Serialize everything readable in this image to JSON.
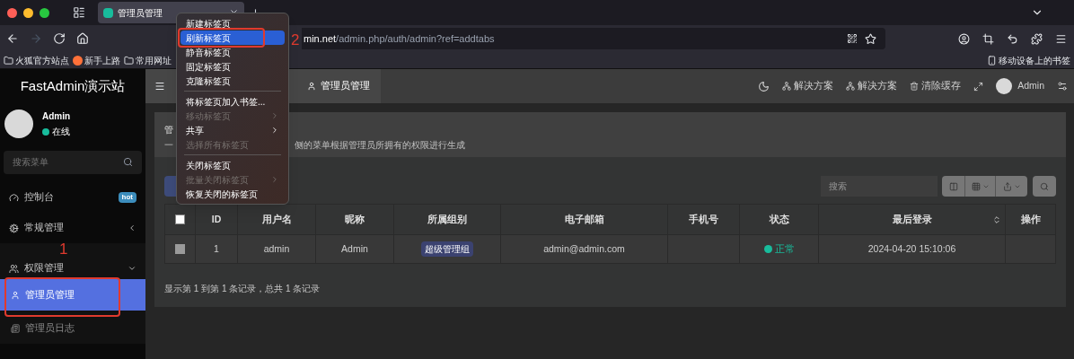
{
  "browser": {
    "tab": {
      "title": "管理员管理"
    },
    "nav_buttons": [
      {
        "kind": "back",
        "disabled": false
      },
      {
        "kind": "forward",
        "disabled": true
      },
      {
        "kind": "reload",
        "disabled": false
      },
      {
        "kind": "home",
        "disabled": false
      }
    ],
    "url": {
      "host": "min.net",
      "path": "/admin.php/auth/admin?ref=addtabs"
    },
    "bookmarks": [
      {
        "label": "火狐官方站点",
        "kind": "folder"
      },
      {
        "label": "新手上路",
        "kind": "firefox"
      },
      {
        "label": "常用网址",
        "kind": "folder"
      }
    ],
    "mobile_bookmarks": "移动设备上的书签"
  },
  "context_menu": {
    "items": [
      {
        "kind": "item",
        "label": "新建标签页",
        "selected": false,
        "disabled": false,
        "submenu": false
      },
      {
        "kind": "item",
        "label": "刷新标签页",
        "selected": true,
        "disabled": false,
        "submenu": false
      },
      {
        "kind": "item",
        "label": "静音标签页",
        "selected": false,
        "disabled": false,
        "submenu": false
      },
      {
        "kind": "item",
        "label": "固定标签页",
        "selected": false,
        "disabled": false,
        "submenu": false
      },
      {
        "kind": "item",
        "label": "克隆标签页",
        "selected": false,
        "disabled": false,
        "submenu": false
      },
      {
        "kind": "separator"
      },
      {
        "kind": "item",
        "label": "将标签页加入书签...",
        "selected": false,
        "disabled": false,
        "submenu": false
      },
      {
        "kind": "item",
        "label": "移动标签页",
        "selected": false,
        "disabled": true,
        "submenu": true
      },
      {
        "kind": "item",
        "label": "共享",
        "selected": false,
        "disabled": false,
        "submenu": true
      },
      {
        "kind": "item",
        "label": "选择所有标签页",
        "selected": false,
        "disabled": true,
        "submenu": false
      },
      {
        "kind": "separator"
      },
      {
        "kind": "item",
        "label": "关闭标签页",
        "selected": false,
        "disabled": false,
        "submenu": false
      },
      {
        "kind": "item",
        "label": "批量关闭标签页",
        "selected": false,
        "disabled": true,
        "submenu": true
      },
      {
        "kind": "item",
        "label": "恢复关闭的标签页",
        "selected": false,
        "disabled": false,
        "submenu": false
      }
    ]
  },
  "annotations": [
    {
      "label": "1"
    },
    {
      "label": "2"
    }
  ],
  "sidebar": {
    "logo": "FastAdmin演示站",
    "user": {
      "name": "Admin",
      "status": "在线"
    },
    "search": {
      "placeholder": "搜索菜单"
    },
    "items": [
      {
        "label": "控制台",
        "badge": "hot"
      },
      {
        "label": "常规管理",
        "expanded": false
      },
      {
        "label": "权限管理",
        "expanded": true,
        "children": [
          {
            "label": "管理员管理",
            "selected": true
          },
          {
            "label": "管理员日志",
            "selected": false
          }
        ]
      }
    ]
  },
  "topbar": {
    "page_tabs": [
      {
        "label": "管理员管理",
        "selected": true
      }
    ],
    "actions": [
      {
        "label": "解决方案"
      },
      {
        "label": "解决方案"
      },
      {
        "label": "清除缓存"
      }
    ],
    "user": "Admin"
  },
  "panel": {
    "title": "管",
    "description_start": "一",
    "description": "侧的菜单根据管理员所拥有的权限进行生成",
    "search": {
      "placeholder": "搜索"
    },
    "table": {
      "header_checked": false,
      "columns": [
        {
          "label": "ID",
          "sortable": false
        },
        {
          "label": "用户名",
          "sortable": false
        },
        {
          "label": "昵称",
          "sortable": false
        },
        {
          "label": "所属组别",
          "sortable": false
        },
        {
          "label": "电子邮箱",
          "sortable": false
        },
        {
          "label": "手机号",
          "sortable": false
        },
        {
          "label": "状态",
          "sortable": false
        },
        {
          "label": "最后登录",
          "sortable": true
        },
        {
          "label": "操作",
          "sortable": false
        }
      ],
      "rows": [
        {
          "checked": false,
          "id": "1",
          "username": "admin",
          "nickname": "Admin",
          "group": "超级管理组",
          "email": "admin@admin.com",
          "status": {
            "label": "正常",
            "color": "#18bc9c"
          },
          "last_login": "2024-04-20 15:10:06"
        }
      ]
    },
    "footer": "显示第 1 到第 1 条记录，总共 1 条记录"
  }
}
